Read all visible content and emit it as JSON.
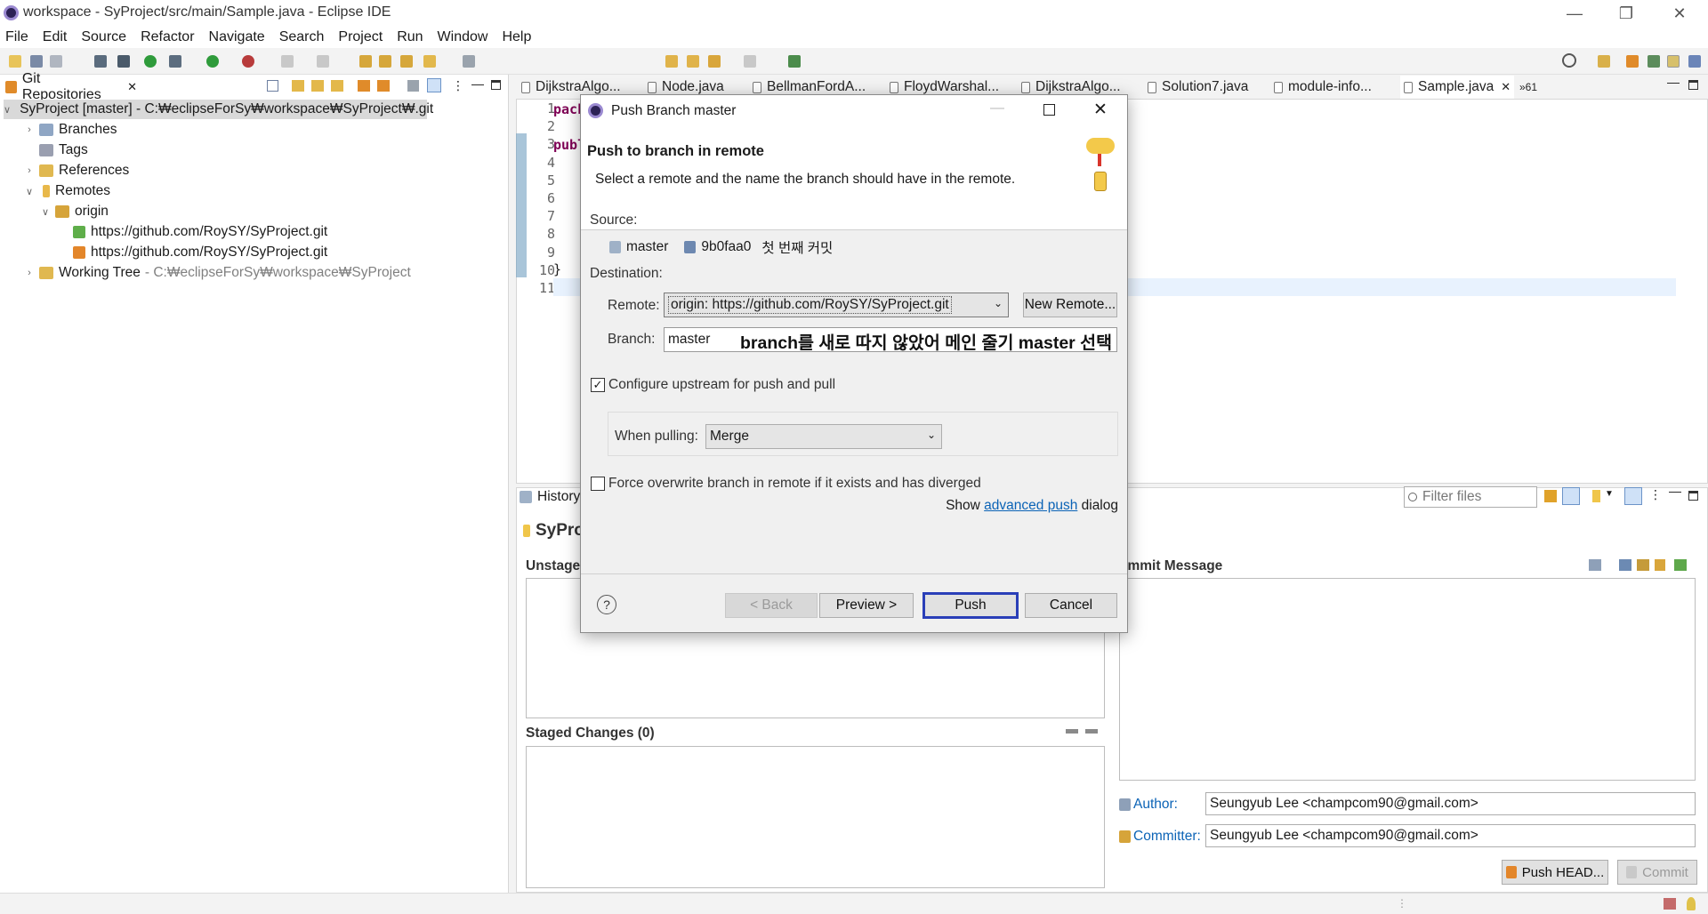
{
  "window": {
    "title": "workspace - SyProject/src/main/Sample.java - Eclipse IDE"
  },
  "menu": [
    "File",
    "Edit",
    "Source",
    "Refactor",
    "Navigate",
    "Search",
    "Project",
    "Run",
    "Window",
    "Help"
  ],
  "git_view": {
    "tab_label": "Git Repositories",
    "repo": "SyProject [master] - C:₩eclipseForSy₩workspace₩SyProject₩.git",
    "branches": "Branches",
    "tags": "Tags",
    "references": "References",
    "remotes": "Remotes",
    "origin": "origin",
    "remote_url_1": "https://github.com/RoySY/SyProject.git",
    "remote_url_2": "https://github.com/RoySY/SyProject.git",
    "working_tree": "Working Tree",
    "working_tree_path": "- C:₩eclipseForSy₩workspace₩SyProject"
  },
  "editor": {
    "tabs": [
      "DijkstraAlgo...",
      "Node.java",
      "BellmanFordA...",
      "FloydWarshal...",
      "DijkstraAlgo...",
      "Solution7.java",
      "module-info...",
      "Sample.java"
    ],
    "overflow": "»61",
    "line_numbers": [
      "1",
      "2",
      "3",
      "4",
      "5",
      "6",
      "7",
      "8",
      "9",
      "10",
      "11"
    ],
    "code_fragments": {
      "l1": "pack",
      "l3": "publ",
      "l10": "}"
    }
  },
  "staging": {
    "history_tab": "History",
    "repo_label": "SyPro",
    "unstaged": "Unstaged",
    "staged": "Staged Changes (0)",
    "commit_message": "ommit Message",
    "filter_placeholder": "Filter files",
    "author_label": "Author:",
    "author_value": "Seungyub Lee <champcom90@gmail.com>",
    "committer_label": "Committer:",
    "committer_value": "Seungyub Lee <champcom90@gmail.com>",
    "push_head": "Push HEAD...",
    "commit": "Commit"
  },
  "dialog": {
    "title": "Push Branch master",
    "heading": "Push to branch in remote",
    "description": "Select a remote and the name the branch should have in the remote.",
    "source_label": "Source:",
    "source_branch": "master",
    "source_commit": "9b0faa0",
    "source_message": "첫 번째 커밋",
    "destination_label": "Destination:",
    "remote_label": "Remote:",
    "remote_value": "origin: https://github.com/RoySY/SyProject.git",
    "new_remote": "New Remote...",
    "branch_label": "Branch:",
    "branch_value": "master",
    "annotation": "branch를 새로 따지 않았어 메인 줄기 master 선택",
    "configure_upstream": "Configure upstream for push and pull",
    "configure_upstream_checked": true,
    "when_pulling_label": "When pulling:",
    "when_pulling_value": "Merge",
    "force_overwrite": "Force overwrite branch in remote if it exists and has diverged",
    "force_overwrite_checked": false,
    "show_prefix": "Show",
    "advanced_push": "advanced push",
    "show_suffix": "dialog",
    "back": "< Back",
    "preview": "Preview >",
    "push": "Push",
    "cancel": "Cancel",
    "help": "?"
  },
  "colors": {
    "accent": "#0b63b6",
    "focus_border": "#2a3fb8",
    "banner_bg": "#ffffff",
    "tree_selection": "#d9d9d9"
  }
}
